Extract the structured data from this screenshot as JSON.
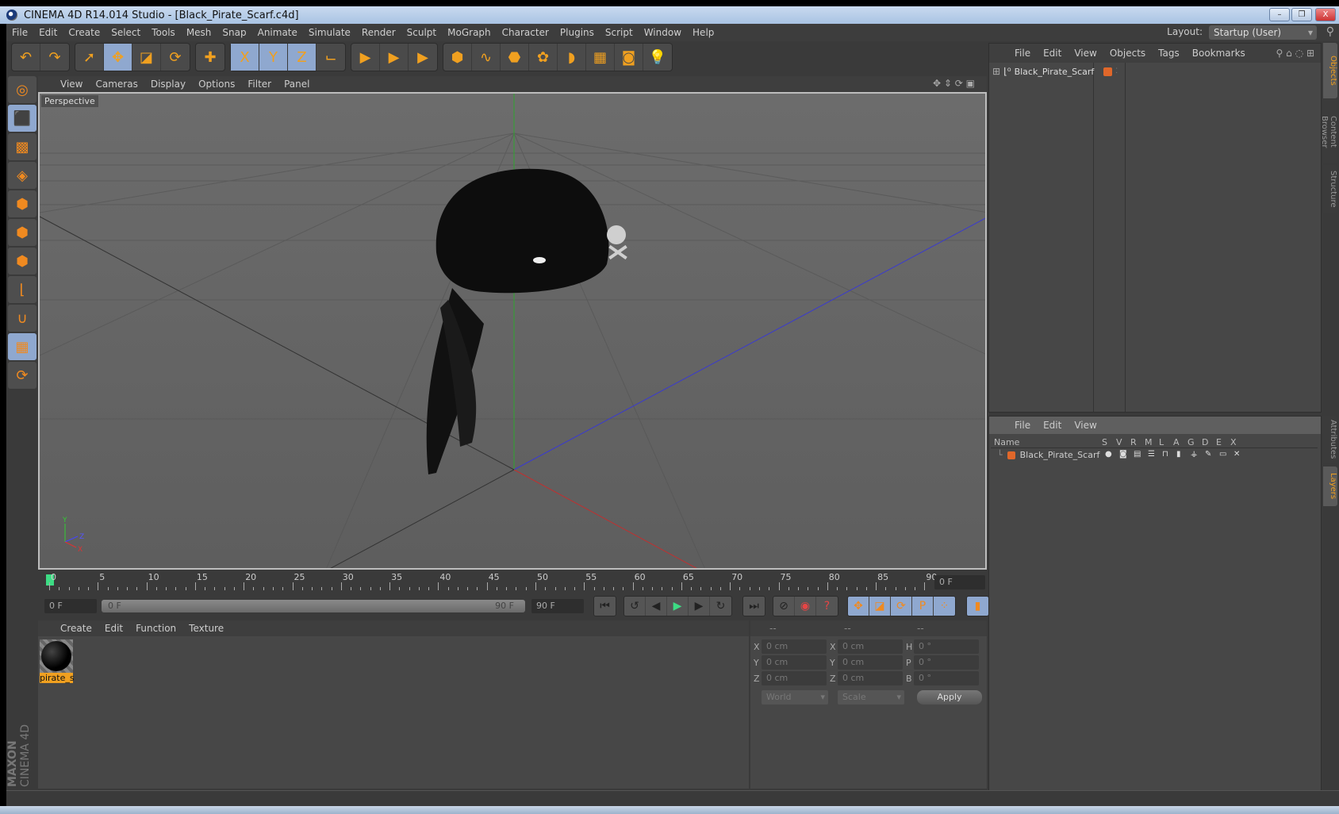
{
  "window": {
    "title": "CINEMA 4D R14.014 Studio - [Black_Pirate_Scarf.c4d]",
    "minimize": "–",
    "restore": "❐",
    "close": "X"
  },
  "menubar": {
    "items": [
      "File",
      "Edit",
      "Create",
      "Select",
      "Tools",
      "Mesh",
      "Snap",
      "Animate",
      "Simulate",
      "Render",
      "Sculpt",
      "MoGraph",
      "Character",
      "Plugins",
      "Script",
      "Window",
      "Help"
    ],
    "layout_label": "Layout:",
    "layout_value": "Startup (User)"
  },
  "toolbar": {
    "groups": [
      [
        {
          "icon": "undo-icon",
          "glyph": "↶"
        },
        {
          "icon": "redo-icon",
          "glyph": "↷"
        }
      ],
      [
        {
          "icon": "live-selection-icon",
          "glyph": "➚"
        },
        {
          "icon": "move-icon",
          "glyph": "✥",
          "selected": true
        },
        {
          "icon": "scale-icon",
          "glyph": "◪"
        },
        {
          "icon": "rotate-icon",
          "glyph": "⟳"
        }
      ],
      [
        {
          "icon": "recent-tool-icon",
          "glyph": "✚"
        }
      ],
      [
        {
          "icon": "x-axis-lock-icon",
          "glyph": "X",
          "selected": true
        },
        {
          "icon": "y-axis-lock-icon",
          "glyph": "Y",
          "selected": true
        },
        {
          "icon": "z-axis-lock-icon",
          "glyph": "Z",
          "selected": true
        },
        {
          "icon": "coordinate-system-icon",
          "glyph": "⌙"
        }
      ],
      [
        {
          "icon": "render-view-icon",
          "glyph": "▶"
        },
        {
          "icon": "render-picture-viewer-icon",
          "glyph": "▶"
        },
        {
          "icon": "render-settings-icon",
          "glyph": "▶"
        }
      ],
      [
        {
          "icon": "cube-icon",
          "glyph": "⬢"
        },
        {
          "icon": "spline-pen-icon",
          "glyph": "∿"
        },
        {
          "icon": "subdivision-icon",
          "glyph": "⬣"
        },
        {
          "icon": "cloner-icon",
          "glyph": "✿"
        },
        {
          "icon": "deformer-icon",
          "glyph": "◗"
        },
        {
          "icon": "floor-icon",
          "glyph": "▦"
        },
        {
          "icon": "camera-icon",
          "glyph": "◙"
        },
        {
          "icon": "light-icon",
          "glyph": "💡"
        }
      ]
    ]
  },
  "left_tools": [
    {
      "icon": "make-editable-icon",
      "glyph": "◎"
    },
    {
      "icon": "model-mode-icon",
      "glyph": "⬛",
      "selected": true
    },
    {
      "icon": "texture-mode-icon",
      "glyph": "▩"
    },
    {
      "icon": "workplane-icon",
      "glyph": "◈"
    },
    {
      "icon": "points-mode-icon",
      "glyph": "⬢"
    },
    {
      "icon": "edges-mode-icon",
      "glyph": "⬢"
    },
    {
      "icon": "polygons-mode-icon",
      "glyph": "⬢"
    },
    {
      "icon": "axis-mode-icon",
      "glyph": "⌊"
    },
    {
      "icon": "snap-magnet-icon",
      "glyph": "∪"
    },
    {
      "icon": "workplane-lock-icon",
      "glyph": "▦",
      "selected": true
    },
    {
      "icon": "locked-workplane-icon",
      "glyph": "⟳"
    }
  ],
  "viewport": {
    "menu": [
      "View",
      "Cameras",
      "Display",
      "Options",
      "Filter",
      "Panel"
    ],
    "label": "Perspective",
    "axis_labels": {
      "y": "Y",
      "z": "Z",
      "x": "X"
    }
  },
  "timeline": {
    "ticks": [
      "0",
      "5",
      "10",
      "15",
      "20",
      "25",
      "30",
      "35",
      "40",
      "45",
      "50",
      "55",
      "60",
      "65",
      "70",
      "75",
      "80",
      "85",
      "90"
    ],
    "current_frame_display": "0 F",
    "start_field": "0 F",
    "range_start": "0 F",
    "range_end": "90 F",
    "end_field": "90 F"
  },
  "playback": {
    "buttons": [
      {
        "icon": "go-to-start-icon",
        "glyph": "⏮"
      },
      {
        "icon": "previous-keyframe-icon",
        "glyph": "↺"
      },
      {
        "icon": "previous-frame-icon",
        "glyph": "◀"
      },
      {
        "icon": "play-icon",
        "glyph": "▶"
      },
      {
        "icon": "next-frame-icon",
        "glyph": "▶"
      },
      {
        "icon": "next-keyframe-icon",
        "glyph": "↻"
      },
      {
        "icon": "go-to-end-icon",
        "glyph": "⏭"
      },
      {
        "icon": "motion-record-icon",
        "glyph": "⊘"
      },
      {
        "icon": "autokey-icon",
        "glyph": "◉"
      },
      {
        "icon": "keyframe-selection-icon",
        "glyph": "?"
      },
      {
        "icon": "key-position-icon",
        "glyph": "✥"
      },
      {
        "icon": "key-scale-icon",
        "glyph": "◪"
      },
      {
        "icon": "key-rotation-icon",
        "glyph": "⟳"
      },
      {
        "icon": "key-parameter-icon",
        "glyph": "P"
      },
      {
        "icon": "key-pla-icon",
        "glyph": "⁘"
      },
      {
        "icon": "timeline-window-icon",
        "glyph": "▮"
      }
    ]
  },
  "material_manager": {
    "menu": [
      "Create",
      "Edit",
      "Function",
      "Texture"
    ],
    "materials": [
      {
        "name": "pirate_s"
      }
    ]
  },
  "coordinates": {
    "headers": [
      "--",
      "--",
      "--"
    ],
    "rows": [
      {
        "l1": "X",
        "v1": "0 cm",
        "l2": "X",
        "v2": "0 cm",
        "l3": "H",
        "v3": "0 °"
      },
      {
        "l1": "Y",
        "v1": "0 cm",
        "l2": "Y",
        "v2": "0 cm",
        "l3": "P",
        "v3": "0 °"
      },
      {
        "l1": "Z",
        "v1": "0 cm",
        "l2": "Z",
        "v2": "0 cm",
        "l3": "B",
        "v3": "0 °"
      }
    ],
    "space_dropdown": "World",
    "mode_dropdown": "Scale",
    "apply_label": "Apply"
  },
  "object_manager": {
    "menu": [
      "File",
      "Edit",
      "View",
      "Objects",
      "Tags",
      "Bookmarks"
    ],
    "objects": [
      {
        "name": "Black_Pirate_Scarf",
        "layer_color": "#e0672a"
      }
    ]
  },
  "layer_manager": {
    "menu": [
      "File",
      "Edit",
      "View"
    ],
    "columns": [
      "Name",
      "S",
      "V",
      "R",
      "M",
      "L",
      "A",
      "G",
      "D",
      "E",
      "X"
    ],
    "layers": [
      {
        "name": "Black_Pirate_Scarf",
        "color": "#e0672a"
      }
    ]
  },
  "side_tabs": {
    "top": [
      "Objects",
      "Content Browser",
      "Structure"
    ],
    "bottom": [
      "Attributes",
      "Layers"
    ]
  },
  "brand": {
    "line1": "MAXON",
    "line2": "CINEMA 4D"
  },
  "colors": {
    "accent": "#f0a020",
    "selected": "#8fa8cf",
    "play": "#3ddc84",
    "record": "#e64545"
  }
}
